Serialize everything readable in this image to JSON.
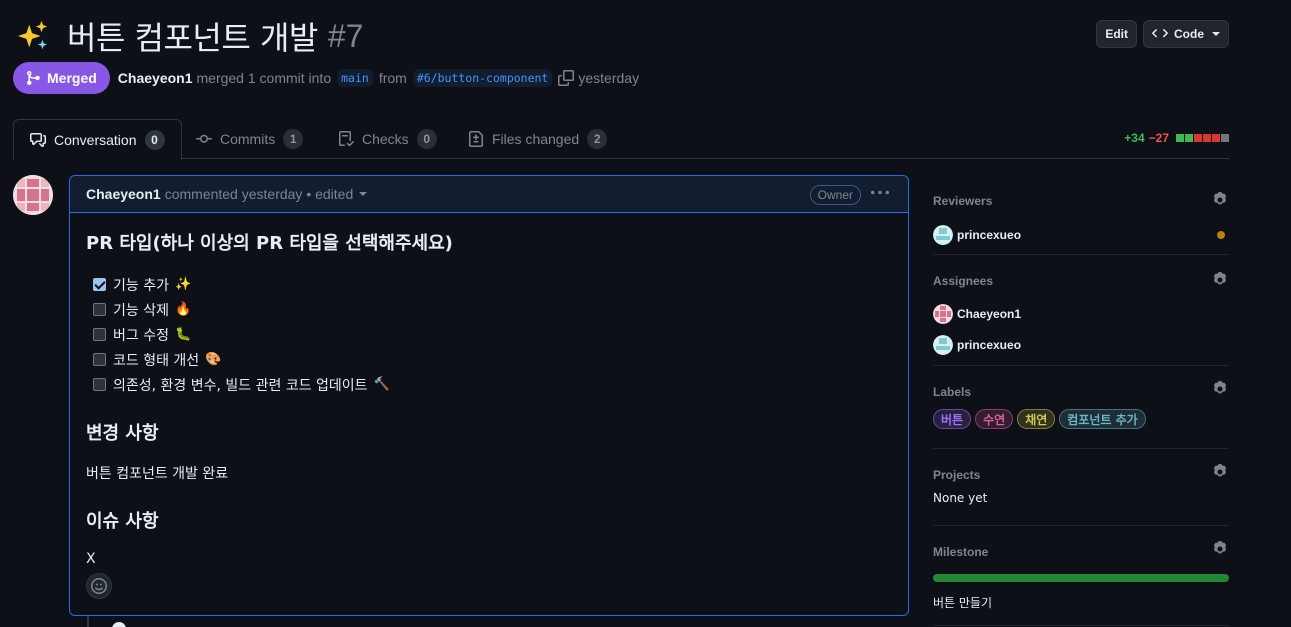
{
  "pr": {
    "title": "버튼 컴포넌트 개발",
    "number": "#7",
    "title_emoji": "sparkles-icon",
    "status": "Merged",
    "author": "Chaeyeon1",
    "merge_text": "merged 1 commit into",
    "base_branch": "main",
    "from_text": "from",
    "head_branch": "#6/button-component",
    "time": "yesterday"
  },
  "header_actions": {
    "edit": "Edit",
    "code": "Code"
  },
  "tabs": [
    {
      "label": "Conversation",
      "count": "0",
      "icon": "comment-discussion-icon"
    },
    {
      "label": "Commits",
      "count": "1",
      "icon": "git-commit-icon"
    },
    {
      "label": "Checks",
      "count": "0",
      "icon": "checklist-icon"
    },
    {
      "label": "Files changed",
      "count": "2",
      "icon": "file-diff-icon"
    }
  ],
  "diffstat": {
    "additions": "+34",
    "deletions": "−27",
    "boxes": [
      "#3fb950",
      "#3fb950",
      "#da3633",
      "#da3633",
      "#da3633",
      "#6e7681"
    ]
  },
  "comment": {
    "author": "Chaeyeon1",
    "meta": "commented yesterday • edited",
    "role": "Owner",
    "heading_type": "PR 타입(하나 이상의 PR 타입을 선택해주세요)",
    "checklist": [
      {
        "text": "기능 추가",
        "checked": true,
        "emoji": "✨"
      },
      {
        "text": "기능 삭제",
        "checked": false,
        "emoji": "🔥"
      },
      {
        "text": "버그 수정",
        "checked": false,
        "emoji": "🐛"
      },
      {
        "text": "코드 형태 개선",
        "checked": false,
        "emoji": "🎨"
      },
      {
        "text": "의존성, 환경 변수, 빌드 관련 코드 업데이트",
        "checked": false,
        "emoji": "🔨"
      }
    ],
    "heading_changes": "변경 사항",
    "changes_text": "버튼 컴포넌트 개발 완료",
    "heading_issues": "이슈 사항",
    "issues_text": "X"
  },
  "sidebar": {
    "reviewers": {
      "title": "Reviewers",
      "users": [
        "princexueo"
      ]
    },
    "assignees": {
      "title": "Assignees",
      "users": [
        "Chaeyeon1",
        "princexueo"
      ]
    },
    "labels": {
      "title": "Labels",
      "items": [
        {
          "text": "버튼",
          "color": "#a371f7"
        },
        {
          "text": "수연",
          "color": "#db61a2"
        },
        {
          "text": "채연",
          "color": "#d4c84a"
        },
        {
          "text": "컴포넌트 추가",
          "color": "#6cb6c7"
        }
      ]
    },
    "projects": {
      "title": "Projects",
      "text": "None yet"
    },
    "milestone": {
      "title": "Milestone",
      "name": "버튼 만들기",
      "progress": 1.0
    }
  },
  "colors": {
    "merged": "#8957e5",
    "accent_blue": "#1f6feb",
    "background": "#0d1117"
  }
}
